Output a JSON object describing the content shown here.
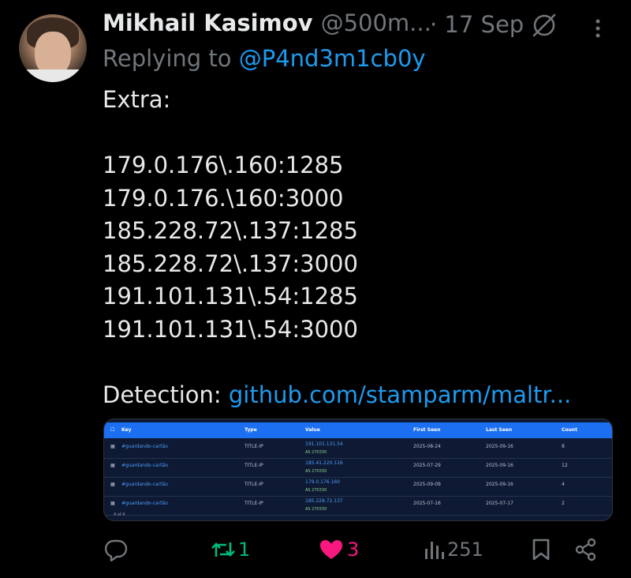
{
  "author": {
    "name": "Mikhail Kasimov",
    "handle": "@500m...",
    "date": "· 17 Sep"
  },
  "reply": {
    "prefix": "Replying to ",
    "mention": "@P4nd3m1cb0y"
  },
  "body": {
    "line1": "Extra:",
    "ips": [
      "179.0.176\\.160:1285",
      "179.0.176.\\160:3000",
      "185.228.72\\.137:1285",
      "185.228.72\\.137:3000",
      "191.101.131\\.54:1285",
      "191.101.131\\.54:3000"
    ],
    "detection_label": "Detection: ",
    "detection_link": "github.com/stamparm/maltr..."
  },
  "media": {
    "headers": [
      "Key",
      "Type",
      "Value",
      "First Seen",
      "Last Seen",
      "Count"
    ],
    "rows": [
      {
        "key": "#guardando-cartão",
        "type": "TITLE-IP",
        "value": "191.101.131.54",
        "asn": "AS 270330",
        "first": "2025-08-24",
        "last": "2025-09-16",
        "count": "8"
      },
      {
        "key": "#guardando-cartão",
        "type": "TITLE-IP",
        "value": "185.41.220.116",
        "asn": "AS 270330",
        "first": "2025-07-29",
        "last": "2025-09-16",
        "count": "12"
      },
      {
        "key": "#guardando-cartão",
        "type": "TITLE-IP",
        "value": "179.0.176.160",
        "asn": "AS 270330",
        "first": "2025-09-09",
        "last": "2025-09-16",
        "count": "4"
      },
      {
        "key": "#guardando-cartão",
        "type": "TITLE-IP",
        "value": "185.228.72.137",
        "asn": "AS 270330",
        "first": "2025-07-16",
        "last": "2025-07-17",
        "count": "2"
      }
    ],
    "footer": "4 of 4"
  },
  "actions": {
    "replies": "",
    "reposts": "1",
    "likes": "3",
    "views": "251"
  },
  "colors": {
    "background": "#000000",
    "text": "#e7e9ea",
    "muted": "#71767b",
    "link": "#1d9bf0",
    "repost": "#00ba7c",
    "like": "#f91880"
  }
}
